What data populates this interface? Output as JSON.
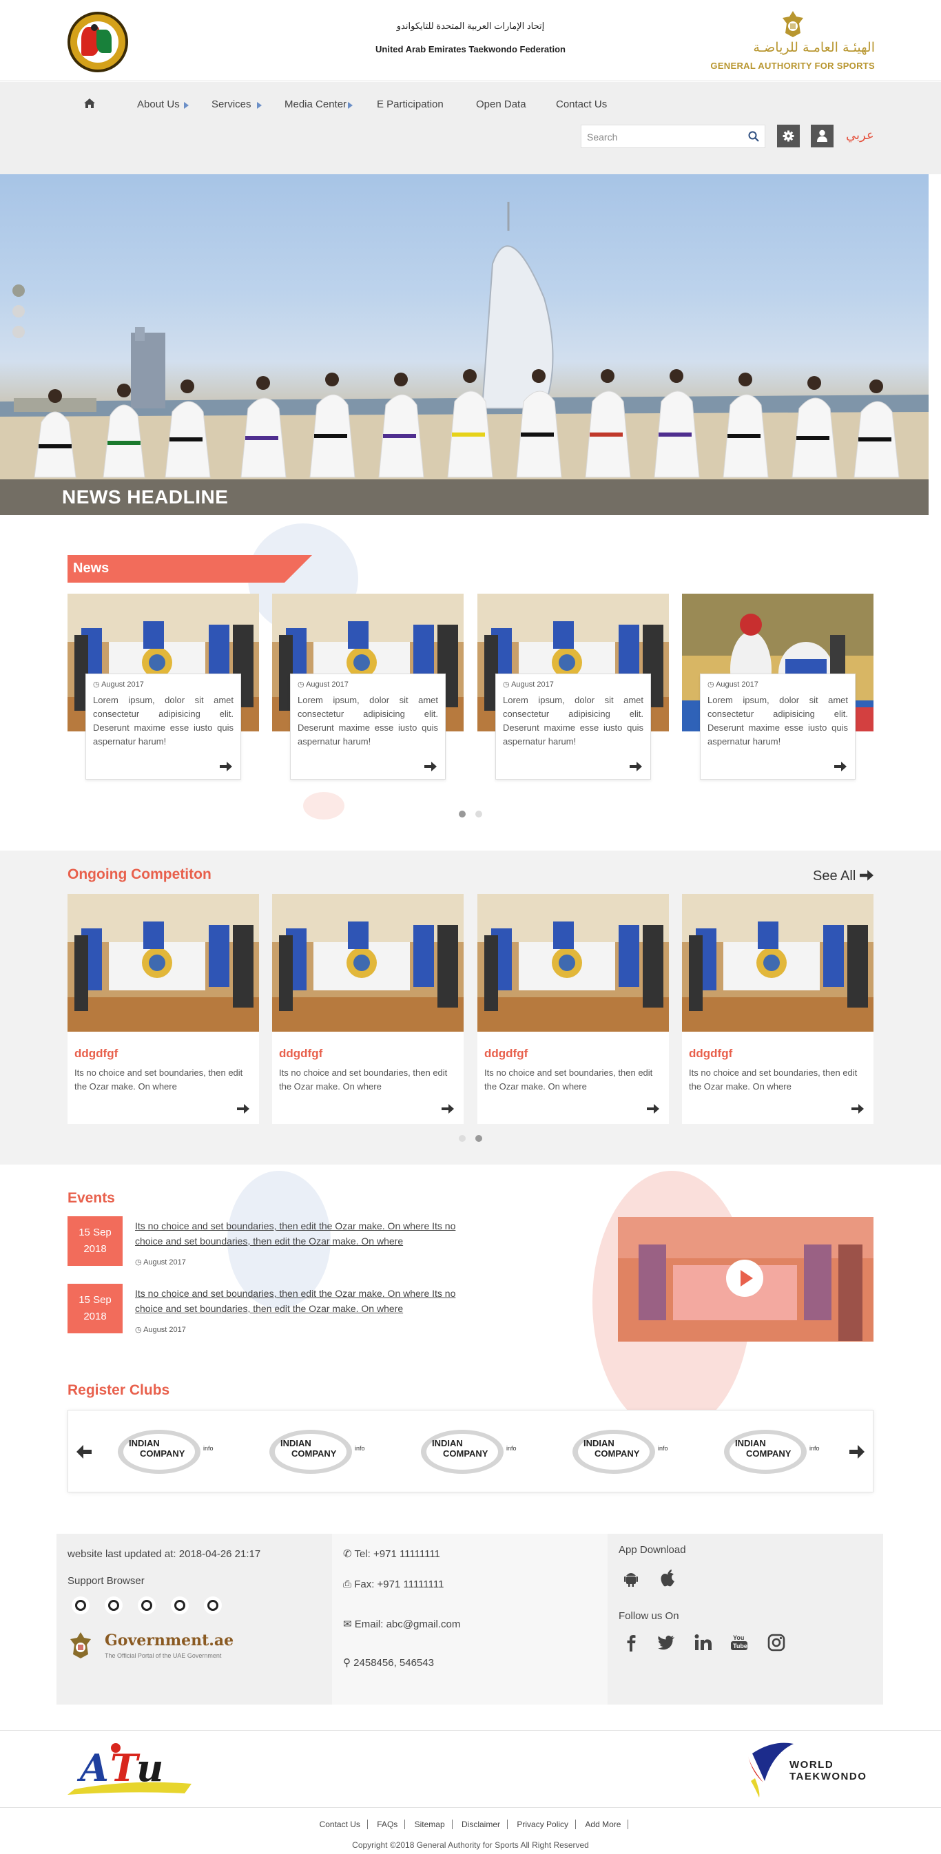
{
  "header": {
    "federation_ar": "إتحاد الإمارات العربية المتحدة للتايكواندو",
    "federation_en": "United Arab Emirates Taekwondo Federation",
    "authority_ar": "الهيئـة العامـة للرياضـة",
    "authority_en": "GENERAL AUTHORITY FOR SPORTS"
  },
  "nav": {
    "items": [
      {
        "label": "About Us"
      },
      {
        "label": "Services"
      },
      {
        "label": "Media Center"
      },
      {
        "label": "E Participation"
      },
      {
        "label": "Open Data"
      },
      {
        "label": "Contact Us"
      }
    ],
    "search_placeholder": "Search",
    "language": "عربي"
  },
  "hero": {
    "headline": "NEWS HEADLINE",
    "slide_count": 3,
    "active_slide": 1
  },
  "news": {
    "title": "News",
    "items": [
      {
        "date": "August 2017",
        "text": "Lorem ipsum, dolor sit amet consectetur adipisicing elit. Deserunt maxime esse iusto quis aspernatur harum!"
      },
      {
        "date": "August 2017",
        "text": "Lorem ipsum, dolor sit amet consectetur adipisicing elit. Deserunt maxime esse iusto quis aspernatur harum!"
      },
      {
        "date": "August 2017",
        "text": "Lorem ipsum, dolor sit amet consectetur adipisicing elit. Deserunt maxime esse iusto quis aspernatur harum!"
      },
      {
        "date": "August 2017",
        "text": "Lorem ipsum, dolor sit amet consectetur adipisicing elit. Deserunt maxime esse iusto quis aspernatur harum!"
      }
    ],
    "page_count": 2,
    "active_page": 1
  },
  "competitions": {
    "title": "Ongoing Competiton",
    "see_all": "See All",
    "items": [
      {
        "title": "ddgdfgf",
        "text": "Its no choice and set boundaries, then edit the Ozar make. On where"
      },
      {
        "title": "ddgdfgf",
        "text": "Its no choice and set boundaries, then edit the Ozar make. On where"
      },
      {
        "title": "ddgdfgf",
        "text": "Its no choice and set boundaries, then edit the Ozar make. On where"
      },
      {
        "title": "ddgdfgf",
        "text": "Its no choice and set boundaries, then edit the Ozar make. On where"
      }
    ],
    "page_count": 2,
    "active_page": 2
  },
  "events": {
    "title": "Events",
    "items": [
      {
        "day": "15 Sep",
        "year": "2018",
        "text": "Its no choice and set boundaries, then edit the Ozar make. On where Its no choice and set boundaries, then edit the Ozar make. On where",
        "date": "August 2017"
      },
      {
        "day": "15 Sep",
        "year": "2018",
        "text": "Its no choice and set boundaries, then edit the Ozar make. On where Its no choice and set boundaries, then edit the Ozar make. On where",
        "date": "August 2017"
      }
    ]
  },
  "clubs": {
    "title": "Register Clubs",
    "logos": [
      {
        "line1": "INDIAN",
        "line2": "COMPANY",
        "suffix": "info"
      },
      {
        "line1": "INDIAN",
        "line2": "COMPANY",
        "suffix": "info"
      },
      {
        "line1": "INDIAN",
        "line2": "COMPANY",
        "suffix": "info"
      },
      {
        "line1": "INDIAN",
        "line2": "COMPANY",
        "suffix": "info"
      },
      {
        "line1": "INDIAN",
        "line2": "COMPANY",
        "suffix": "info"
      }
    ]
  },
  "footer": {
    "last_updated": "website last updated at: 2018-04-26 21:17",
    "support_browser": "Support Browser",
    "gov_name": "Government.ae",
    "gov_tagline": "The Official Portal of the UAE Government",
    "tel": "Tel: +971 11111111",
    "fax": "Fax: +971 11111111",
    "email": "Email: abc@gmail.com",
    "address": "2458456, 546543",
    "app_download": "App Download",
    "follow_us": "Follow us On",
    "partner_right_1": "WORLD",
    "partner_right_2": "TAEKWONDO",
    "links": [
      "Contact Us",
      "FAQs",
      "Sitemap",
      "Disclaimer",
      "Privacy Policy",
      "Add More"
    ],
    "copyright": "Copyright ©2018 General Authority for Sports All Right Reserved"
  },
  "colors": {
    "accent": "#e8604c",
    "accent_bg": "#f26c5b",
    "nav_band": "#efefef",
    "dark_button": "#555555"
  }
}
